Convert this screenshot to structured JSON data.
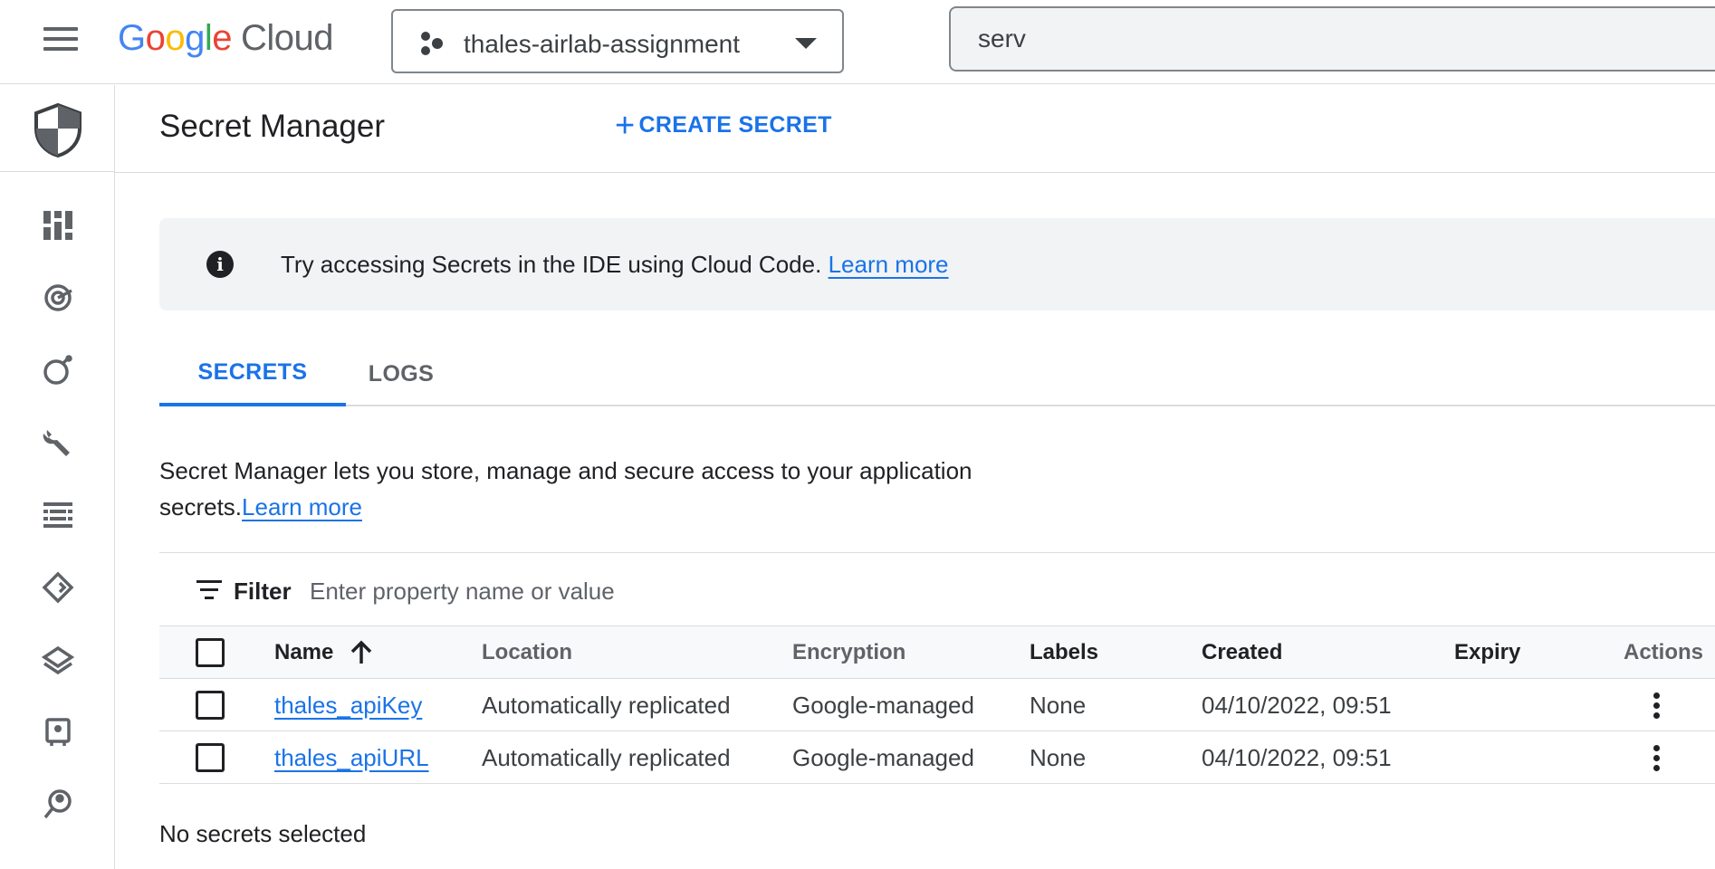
{
  "header": {
    "logo_letters": [
      {
        "char": "G",
        "color": "#4285f4"
      },
      {
        "char": "o",
        "color": "#ea4335"
      },
      {
        "char": "o",
        "color": "#fbbc05"
      },
      {
        "char": "g",
        "color": "#4285f4"
      },
      {
        "char": "l",
        "color": "#34a853"
      },
      {
        "char": "e",
        "color": "#ea4335"
      }
    ],
    "logo_suffix": "Cloud",
    "project_name": "thales-airlab-assignment",
    "search_value": "serv"
  },
  "rail": {
    "header_icon": "security-shield-icon",
    "items": [
      "dashboard-icon",
      "shield-radar-icon",
      "bomb-icon",
      "wrench-icon",
      "list-table-icon",
      "diamond-route-icon",
      "layers-icon",
      "building-icon",
      "person-search-icon"
    ]
  },
  "page": {
    "title": "Secret Manager",
    "create_label": "CREATE SECRET"
  },
  "banner": {
    "icon": "info-icon",
    "text": "Try accessing Secrets in the IDE using Cloud Code.",
    "link": "Learn more"
  },
  "tabs": [
    {
      "label": "SECRETS",
      "active": true
    },
    {
      "label": "LOGS",
      "active": false
    }
  ],
  "description": {
    "text": "Secret Manager lets you store, manage and secure access to your application secrets.",
    "link": "Learn more"
  },
  "filter": {
    "label": "Filter",
    "placeholder": "Enter property name or value"
  },
  "table": {
    "columns": {
      "name": "Name",
      "location": "Location",
      "encryption": "Encryption",
      "labels": "Labels",
      "created": "Created",
      "expiry": "Expiry",
      "actions": "Actions"
    },
    "rows": [
      {
        "name": "thales_apiKey",
        "location": "Automatically replicated",
        "encryption": "Google-managed",
        "labels": "None",
        "created": "04/10/2022, 09:51",
        "expiry": ""
      },
      {
        "name": "thales_apiURL",
        "location": "Automatically replicated",
        "encryption": "Google-managed",
        "labels": "None",
        "created": "04/10/2022, 09:51",
        "expiry": ""
      }
    ]
  },
  "status": "No secrets selected",
  "colors": {
    "accent": "#1a73e8",
    "text": "#202124",
    "muted": "#5f6368",
    "banner_bg": "#f1f3f4"
  }
}
